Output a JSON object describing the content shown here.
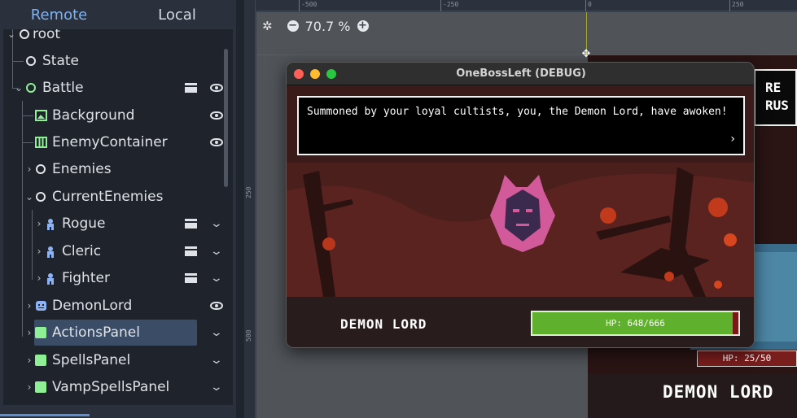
{
  "dock": {
    "tabs": [
      {
        "label": "Remote",
        "active": true
      },
      {
        "label": "Local",
        "active": false
      }
    ],
    "tree": [
      {
        "label": "root"
      },
      {
        "label": "State"
      },
      {
        "label": "Battle"
      },
      {
        "label": "Background"
      },
      {
        "label": "EnemyContainer"
      },
      {
        "label": "Enemies"
      },
      {
        "label": "CurrentEnemies"
      },
      {
        "label": "Rogue"
      },
      {
        "label": "Cleric"
      },
      {
        "label": "Fighter"
      },
      {
        "label": "DemonLord"
      },
      {
        "label": "ActionsPanel"
      },
      {
        "label": "SpellsPanel"
      },
      {
        "label": "VampSpellsPanel"
      }
    ]
  },
  "viewport": {
    "zoom": "70.7 %",
    "zoom_out": "−",
    "zoom_in": "+",
    "ruler_h": [
      "-500",
      "-250",
      "0",
      "250"
    ],
    "ruler_v": [
      "250",
      "500"
    ]
  },
  "debug_window": {
    "title": "OneBossLeft (DEBUG)",
    "dialog_text": "Summoned by your loyal cultists, you, the Demon Lord, have awoken!",
    "dialog_next": "›",
    "boss_name": "DEMON LORD",
    "hp_text": "HP: 648/666",
    "hp_fraction": 0.973
  },
  "scene_behind": {
    "banner_lines": [
      "RE",
      "RUS"
    ],
    "hp_text": "HP: 25/50",
    "name": "DEMON LORD"
  },
  "colors": {
    "accent": "#7db3f2",
    "selection": "#3a4c66",
    "hp_green": "#5fb02c",
    "hp_red": "#7a1818",
    "traffic_close": "#ff5f57",
    "traffic_min": "#febc2e",
    "traffic_max": "#28c840"
  }
}
